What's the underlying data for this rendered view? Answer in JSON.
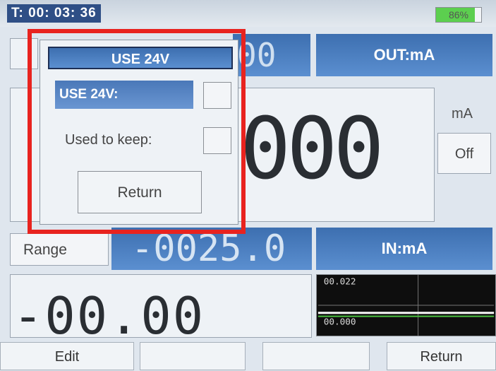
{
  "status": {
    "timer": "T: 00: 03: 36",
    "battery_pct_label": "86%",
    "battery_level": 0.86
  },
  "source": {
    "value_top": "00",
    "out_mode": "OUT:mA",
    "main_value": "000",
    "unit": "mA",
    "off_label": "Off"
  },
  "range": {
    "button_label": "Range",
    "value": "-0025.0"
  },
  "measure": {
    "in_mode": "IN:mA",
    "value": "-00.00",
    "chart_labels": [
      "00.022",
      "00.000"
    ]
  },
  "softkeys": [
    "Edit",
    "",
    "",
    "Return"
  ],
  "dialog": {
    "title": "USE 24V",
    "option1": "USE 24V:",
    "option2": "Used to keep:",
    "return_label": "Return"
  },
  "colors": {
    "highlight": "#e8231f",
    "accent_blue": "#3d6fb0"
  }
}
